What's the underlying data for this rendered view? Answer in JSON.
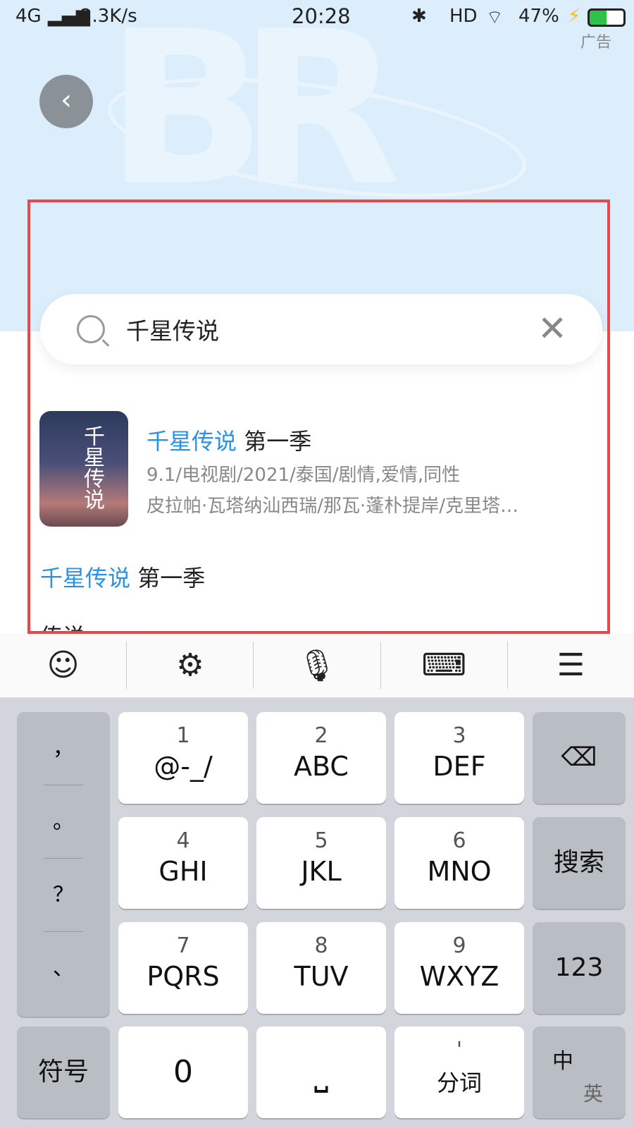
{
  "status": {
    "network": "4G",
    "speed": "2.3K/s",
    "time": "20:28",
    "hd": "HD",
    "battery": "47%",
    "ad": "广告"
  },
  "search": {
    "query": "千星传说",
    "clear_icon": "close-icon"
  },
  "result": {
    "title_hl": "千星传说",
    "title_rest": " 第一季",
    "poster_text": "千星传说",
    "meta": "9.1/电视剧/2021/泰国/剧情,爱情,同性",
    "cast": "皮拉帕·瓦塔纳汕西瑞/那瓦·蓬朴提岸/克里塔…"
  },
  "suggestions": [
    {
      "hl": "千星传说",
      "rest": " 第一季"
    },
    {
      "hl": "",
      "rest": "传说"
    }
  ],
  "keyboard": {
    "toolbar": [
      "☺",
      "⚙",
      "🎙",
      "⌨",
      "☰"
    ],
    "punct": [
      "，",
      "。",
      "？",
      "、"
    ],
    "keys": [
      {
        "n": "1",
        "l": "@-_/"
      },
      {
        "n": "2",
        "l": "ABC"
      },
      {
        "n": "3",
        "l": "DEF"
      },
      {
        "n": "4",
        "l": "GHI"
      },
      {
        "n": "5",
        "l": "JKL"
      },
      {
        "n": "6",
        "l": "MNO"
      },
      {
        "n": "7",
        "l": "PQRS"
      },
      {
        "n": "8",
        "l": "TUV"
      },
      {
        "n": "9",
        "l": "WXYZ"
      }
    ],
    "backspace": "⌫",
    "search": "搜索",
    "num": "123",
    "symbols": "符号",
    "zero": "0",
    "space": "⎵",
    "split_top": "'",
    "split": "分词",
    "lang_zh": "中",
    "lang_en": "英"
  },
  "colors": {
    "accent": "#2a92e6",
    "highlight_box": "#e9474a"
  }
}
